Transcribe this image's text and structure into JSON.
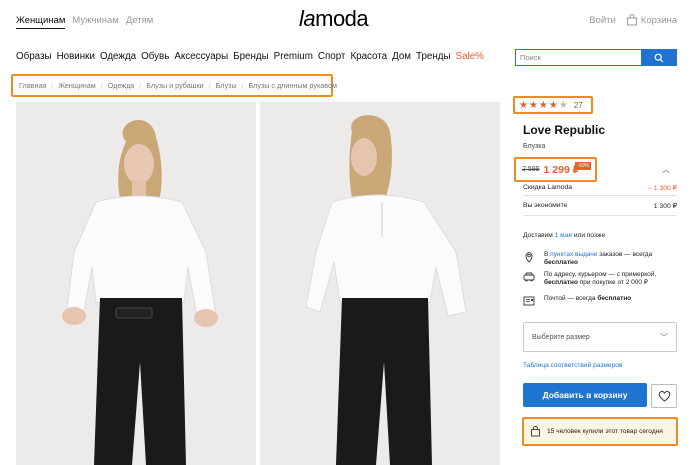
{
  "header": {
    "gender_tabs": [
      "Женщинам",
      "Мужчинам",
      "Детям"
    ],
    "active_gender": "Женщинам",
    "logo": "lamoda",
    "login": "Войти",
    "cart": "Корзина"
  },
  "nav": {
    "items": [
      "Образы",
      "Новинки",
      "Одежда",
      "Обувь",
      "Аксессуары",
      "Бренды",
      "Premium",
      "Спорт",
      "Красота",
      "Дом",
      "Тренды",
      "Sale%"
    ]
  },
  "search": {
    "placeholder": "Поиск"
  },
  "breadcrumbs": [
    "Главная",
    "Женщинам",
    "Одежда",
    "Блузы и рубашки",
    "Блузы",
    "Блузы с длинным рукавом"
  ],
  "product": {
    "rating_stars": "★★★★",
    "rating_empty": "★",
    "rating_value": 4,
    "review_count": "27",
    "brand": "Love Republic",
    "type": "Блузка",
    "old_price": "2 599",
    "new_price": "1 299 ₽",
    "discount_badge": "-50%",
    "discount_label": "Скидка Lamoda",
    "discount_value": "– 1 300 ₽",
    "savings_label": "Вы экономите",
    "savings_value": "1 300 ₽"
  },
  "delivery": {
    "prefix": "Доставим",
    "date": "1 мая",
    "suffix": "или позже",
    "options": [
      {
        "icon": "map-pin-icon",
        "pre": "В",
        "link": "пунктах выдачи",
        "text": "заказов — всегда",
        "bold": "бесплатно"
      },
      {
        "icon": "car-icon",
        "text": "По адресу, курьером — с примеркой,",
        "bold": "бесплатно",
        "tail": "при покупке от 2 000 ₽"
      },
      {
        "icon": "mail-icon",
        "text": "Почтой — всегда",
        "bold": "бесплатно"
      }
    ]
  },
  "size_select": {
    "placeholder": "Выберите размер"
  },
  "size_table_link": "Таблица соответствий размеров",
  "add_to_cart": "Добавить в корзину",
  "popularity": "15 человек купили этот товар сегодня",
  "colors": {
    "accent": "#1f74d1",
    "sale": "#e95e2b",
    "highlight": "#f08a24"
  }
}
